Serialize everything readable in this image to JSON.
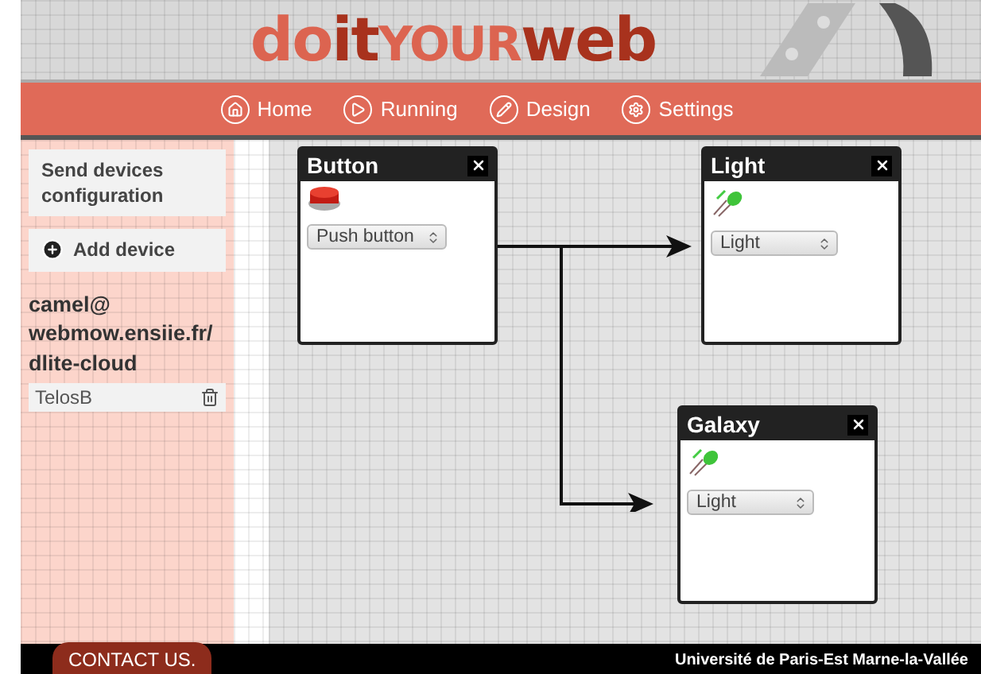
{
  "logo": {
    "parts": [
      "do",
      "it",
      "YOUR",
      "web"
    ]
  },
  "nav": [
    {
      "label": "Home"
    },
    {
      "label": "Running"
    },
    {
      "label": "Design"
    },
    {
      "label": "Settings"
    }
  ],
  "sidebar": {
    "send_button": "Send devices configuration",
    "add_button": "Add device",
    "server": "camel@ webmow.ensiie.fr/ dlite-cloud",
    "devices": [
      {
        "name": "TelosB"
      }
    ]
  },
  "nodes": [
    {
      "title": "Button",
      "kind": "button",
      "select": "Push button"
    },
    {
      "title": "Light",
      "kind": "led",
      "select": "Light"
    },
    {
      "title": "Galaxy",
      "kind": "led",
      "select": "Light"
    }
  ],
  "footer": {
    "contact": "CONTACT US.",
    "university": "Université de Paris-Est Marne-la-Vallée"
  }
}
